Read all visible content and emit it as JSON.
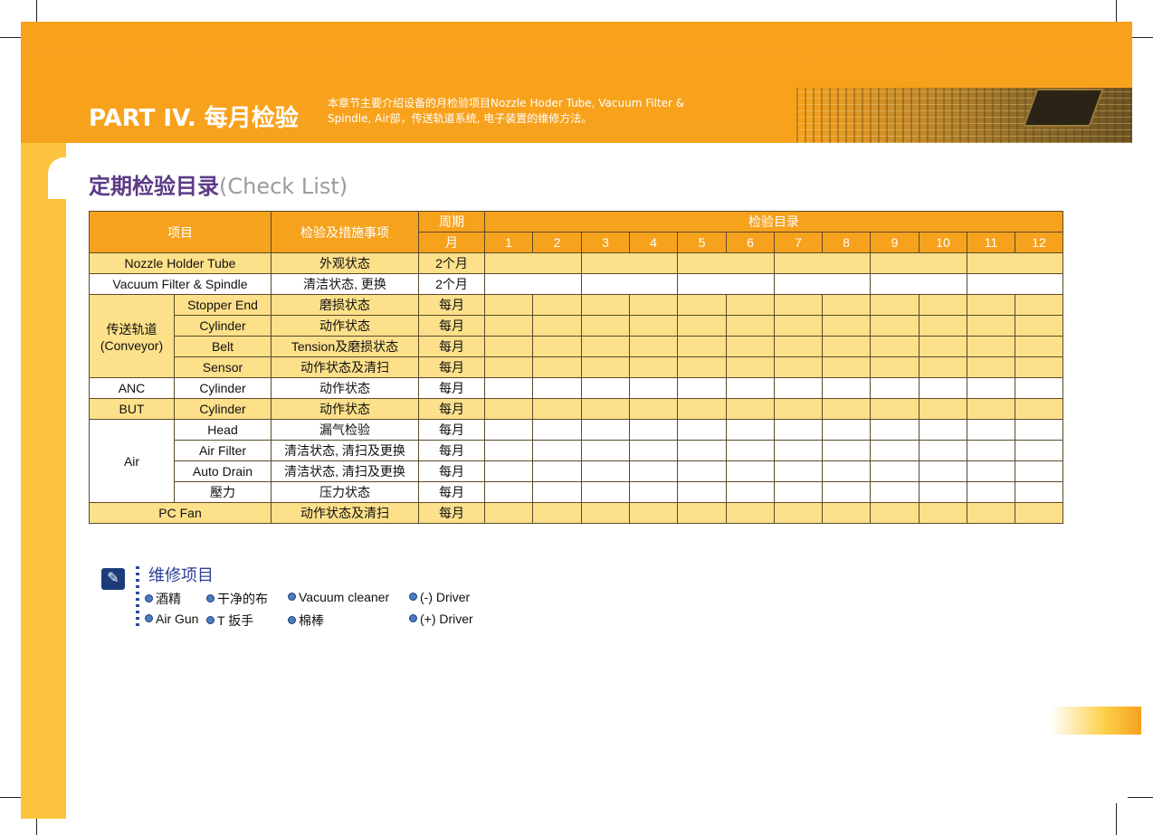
{
  "header": {
    "part_title": "PART IV. 每月检验",
    "description_line1": "本章节主要介绍设备的月检验项目Nozzle Hoder Tube, Vacuum Filter &",
    "description_line2": "Spindle, Air部，传送轨道系统, 电子装置的维修方法。"
  },
  "section": {
    "title_cn": "定期检验目录",
    "title_en": "(Check List)"
  },
  "table": {
    "col_item": "项目",
    "col_check": "检验及措施事项",
    "col_period": "周期",
    "col_list": "检验目录",
    "period_unit": "月",
    "months": [
      "1",
      "2",
      "3",
      "4",
      "5",
      "6",
      "7",
      "8",
      "9",
      "10",
      "11",
      "12"
    ],
    "nozzle": {
      "item": "Nozzle Holder Tube",
      "check": "外观状态",
      "period": "2个月"
    },
    "vacuum": {
      "item": "Vacuum Filter & Spindle",
      "check": "清洁状态, 更换",
      "period": "2个月"
    },
    "conveyor": {
      "group": "传送轨道",
      "group_en": "(Conveyor)",
      "rows": [
        {
          "sub": "Stopper End",
          "check": "磨损状态",
          "period": "每月"
        },
        {
          "sub": "Cylinder",
          "check": "动作状态",
          "period": "每月"
        },
        {
          "sub": "Belt",
          "check": "Tension及磨损状态",
          "period": "每月"
        },
        {
          "sub": "Sensor",
          "check": "动作状态及清扫",
          "period": "每月"
        }
      ]
    },
    "anc": {
      "item": "ANC",
      "sub": "Cylinder",
      "check": "动作状态",
      "period": "每月"
    },
    "but": {
      "item": "BUT",
      "sub": "Cylinder",
      "check": "动作状态",
      "period": "每月"
    },
    "air": {
      "group": "Air",
      "rows": [
        {
          "sub": "Head",
          "check": "漏气检验",
          "period": "每月"
        },
        {
          "sub": "Air Filter",
          "check": "清洁状态, 清扫及更换",
          "period": "每月"
        },
        {
          "sub": "Auto Drain",
          "check": "清洁状态, 清扫及更换",
          "period": "每月"
        },
        {
          "sub": "壓力",
          "check": "压力状态",
          "period": "每月"
        }
      ]
    },
    "pcfan": {
      "item": "PC Fan",
      "check": "动作状态及清扫",
      "period": "每月"
    }
  },
  "tools": {
    "title": "维修项目",
    "row1": [
      "酒精",
      "干净的布",
      "Vacuum cleaner",
      "(-) Driver"
    ],
    "row2": [
      "Air Gun",
      "T 扳手",
      "棉棒",
      "(+) Driver"
    ]
  },
  "colors": {
    "orange": "#f7a21d",
    "yellow_row": "#fde08a",
    "side_bar": "#fcc43e",
    "title_purple": "#5c3a86",
    "tools_blue": "#2c3e95"
  },
  "icons": {
    "tools_icon": "pencil-icon"
  }
}
